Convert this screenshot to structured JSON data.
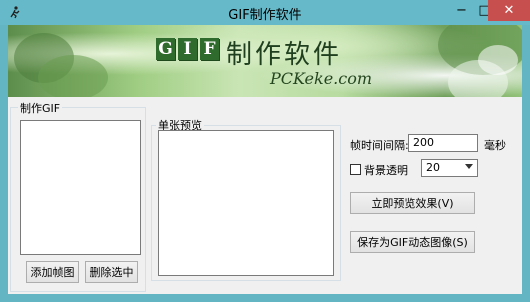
{
  "window": {
    "title": "GIF制作软件",
    "controls": {
      "minimize": "−",
      "maximize": "□",
      "close": "✕"
    }
  },
  "banner": {
    "logo_letters": [
      "G",
      "I",
      "F"
    ],
    "logo_text": "制作软件",
    "logo_url": "PCKeke.com"
  },
  "left_panel": {
    "label": "制作GIF",
    "add_button": "添加帧图",
    "delete_button": "删除选中"
  },
  "preview_panel": {
    "label": "单张预览"
  },
  "settings": {
    "interval_label": "帧时间间隔:",
    "interval_value": "200",
    "interval_unit": "毫秒",
    "transparent_label": "背景透明",
    "transparent_checked": false,
    "transparent_value": "20",
    "preview_button": "立即预览效果(V)",
    "save_button": "保存为GIF动态图像(S)"
  },
  "colors": {
    "titlebar": "#66b9c8",
    "close": "#c7504f",
    "logo_green": "#2f6b2d"
  }
}
